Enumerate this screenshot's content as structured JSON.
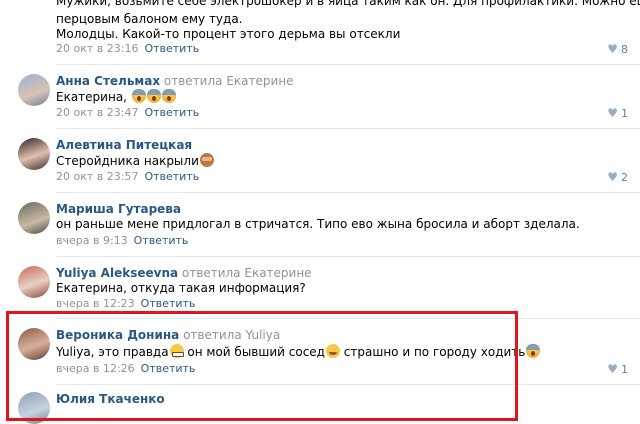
{
  "comments": [
    {
      "text_lines": [
        "Мужики, возьмите себе электрошокер и в яйца таким как он. Для профилактики. Можно еще",
        "перцовым балоном ему туда.",
        "Молодцы. Какой-то процент этого дерьма вы отсекли"
      ],
      "time": "20 окт в 23:16",
      "reply_label": "Ответить",
      "likes": "8"
    },
    {
      "author": "Анна Стельмах",
      "replied_word": "ответила",
      "replied_to": "Екатерине",
      "text": "Екатерина,",
      "time": "20 окт в 23:47",
      "reply_label": "Ответить",
      "likes": "1",
      "avatar_colors": [
        "#8fa7c4",
        "#d9c7b8"
      ]
    },
    {
      "author": "Алевтина Питецкая",
      "text": "Стеройдника накрыли",
      "time": "20 окт в 23:57",
      "reply_label": "Ответить",
      "likes": "2",
      "avatar_colors": [
        "#3a2a2a",
        "#e2c2b3"
      ]
    },
    {
      "author": "Мариша Гутарева",
      "text": "он раньше мене придлогал в стричатся. Типо ево жына бросила и аборт зделала.",
      "time": "вчера в 9:13",
      "reply_label": "Ответить",
      "likes": "",
      "avatar_colors": [
        "#6d6a5f",
        "#c9b9a5"
      ]
    },
    {
      "author": "Yuliya Alekseevna",
      "replied_word": "ответила",
      "replied_to": "Екатерине",
      "text": "Екатерина, откуда такая информация?",
      "time": "вчера в 12:23",
      "reply_label": "Ответить",
      "likes": "",
      "avatar_colors": [
        "#c46a5a",
        "#e9d0c2"
      ]
    },
    {
      "author": "Вероника Донина",
      "replied_word": "ответила",
      "replied_to": "Yuliya",
      "text_parts": [
        "Yuliya, это правда",
        " он мой бывший сосед",
        " страшно и по городу ходить"
      ],
      "time": "вчера в 12:26",
      "reply_label": "Ответить",
      "likes": "1",
      "avatar_colors": [
        "#8a5a4a",
        "#d8b09a"
      ]
    },
    {
      "author": "Юлия Ткаченко",
      "avatar_colors": [
        "#8fa0b8",
        "#c8d3df"
      ]
    }
  ],
  "icons": {
    "like": "heart-icon"
  },
  "colors": {
    "link": "#2a5885",
    "meta": "#939393",
    "highlight": "#e3141b"
  }
}
